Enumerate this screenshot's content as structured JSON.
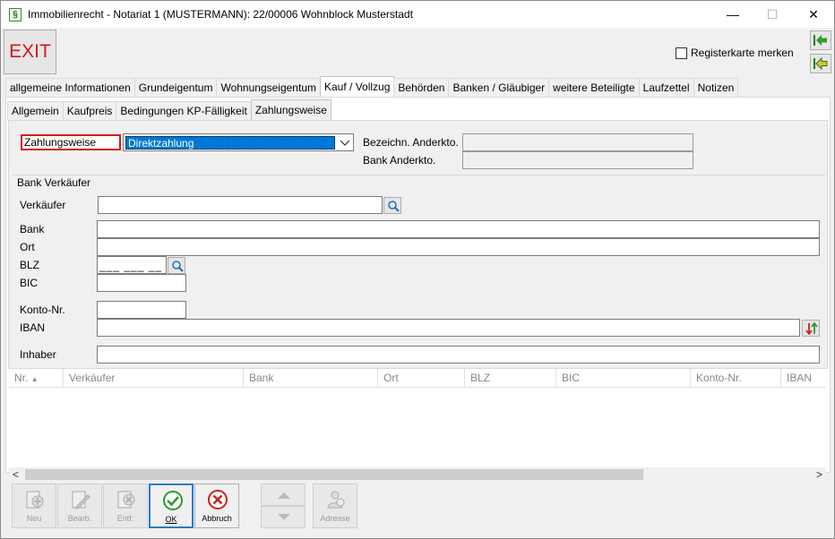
{
  "window": {
    "title": "Immobilienrecht - Notariat 1 (MUSTERMANN): 22/00006 Wohnblock Musterstadt",
    "app_icon": "§",
    "minimize": "—",
    "maximize": "☐",
    "close": "✕"
  },
  "toolbar": {
    "exit_label": "EXIT",
    "remember_tab_label": "Registerkarte merken"
  },
  "main_tabs": [
    "allgemeine Informationen",
    "Grundeigentum",
    "Wohnungseigentum",
    "Kauf / Vollzug",
    "Behörden",
    "Banken / Gläubiger",
    "weitere Beteiligte",
    "Laufzettel",
    "Notizen"
  ],
  "sub_tabs": [
    "Allgemein",
    "Kaufpreis",
    "Bedingungen KP-Fälligkeit",
    "Zahlungsweise"
  ],
  "form": {
    "payment_label": "Zahlungsweise",
    "payment_value": "Direktzahlung",
    "escrow_name_label": "Bezeichn. Anderkto.",
    "escrow_bank_label": "Bank Anderkto.",
    "group_label": "Bank Verkäufer",
    "seller_label": "Verkäufer",
    "bank_label": "Bank",
    "city_label": "Ort",
    "blz_label": "BLZ",
    "blz_mask": "___ ___ __",
    "bic_label": "BIC",
    "account_label": "Konto-Nr.",
    "iban_label": "IBAN",
    "holder_label": "Inhaber"
  },
  "table": {
    "columns": [
      "Nr.",
      "Verkäufer",
      "Bank",
      "Ort",
      "BLZ",
      "BIC",
      "Konto-Nr.",
      "IBAN"
    ],
    "sort_indicator": "▲"
  },
  "scroll": {
    "left": "<",
    "right": ">"
  },
  "buttons": {
    "new": "Neu",
    "edit": "Bearb.",
    "delete": "Entf.",
    "ok": "OK",
    "cancel": "Abbruch",
    "address": "Adresse"
  }
}
